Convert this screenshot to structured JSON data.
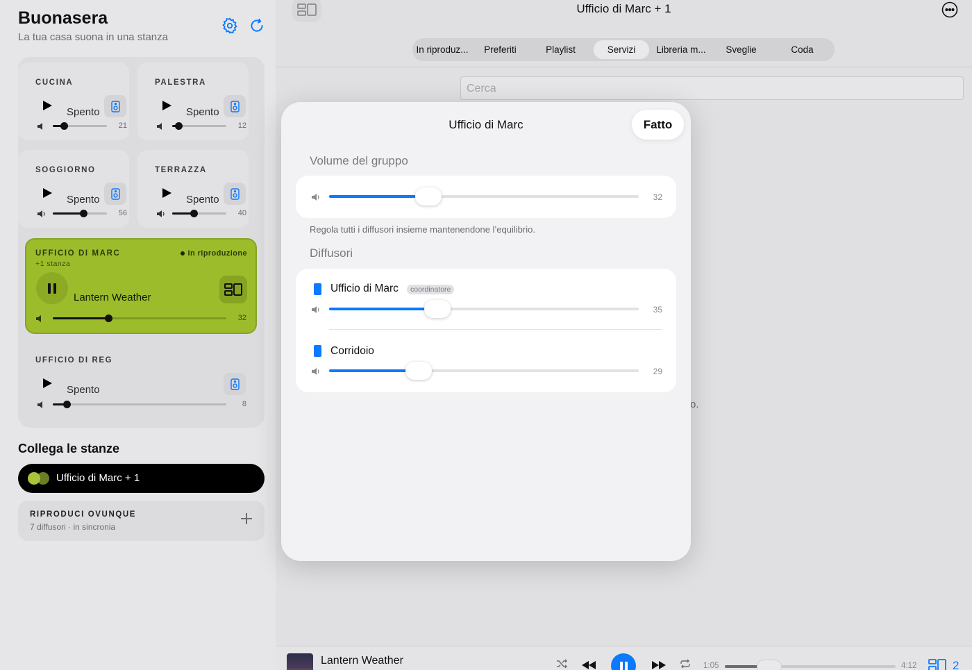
{
  "sidebar": {
    "greeting": "Buonasera",
    "subtitle": "La tua casa suona in una stanza",
    "icons": {
      "settings": "gear-icon",
      "refresh": "refresh-icon"
    },
    "rooms": [
      {
        "name": "CUCINA",
        "status": "Spento",
        "volume": "21",
        "volume_value": 21
      },
      {
        "name": "PALESTRA",
        "status": "Spento",
        "volume": "12",
        "volume_value": 12
      },
      {
        "name": "SOGGIORNO",
        "status": "Spento",
        "volume": "56",
        "volume_value": 56
      },
      {
        "name": "TERRAZZA",
        "status": "Spento",
        "volume": "40",
        "volume_value": 40
      }
    ],
    "active_room": {
      "name": "UFFICIO DI MARC",
      "sub": "+1 stanza",
      "badge": "In riproduzione",
      "track": "Lantern Weather",
      "volume": "32",
      "volume_value": 32,
      "accent": "#9cbc2c"
    },
    "room5": {
      "name": "UFFICIO DI REG",
      "status": "Spento",
      "volume": "8",
      "volume_value": 8
    },
    "link_section_title": "Collega le stanze",
    "link_pill_label": "Ufficio di Marc + 1",
    "anywhere": {
      "title": "RIPRODUCI OVUNQUE",
      "sub": "7 diffusori · in sincronia"
    }
  },
  "main": {
    "title": "Ufficio di Marc + 1",
    "tabs": [
      {
        "label": "In riproduz..."
      },
      {
        "label": "Preferiti"
      },
      {
        "label": "Playlist"
      },
      {
        "label": "Servizi"
      },
      {
        "label": "Libreria m..."
      },
      {
        "label": "Sveglie"
      },
      {
        "label": "Coda"
      }
    ],
    "active_tab": "Servizi",
    "search_placeholder": "Cerca",
    "background_fragment": "o."
  },
  "now_playing": {
    "title": "Lantern Weather",
    "elapsed": "1:05",
    "duration": "4:12",
    "progress": 0.26,
    "group_count": "2",
    "accent": "#0a7aff"
  },
  "modal": {
    "title": "Ufficio di Marc",
    "done_label": "Fatto",
    "group_volume_heading": "Volume del gruppo",
    "group_volume": "32",
    "group_volume_value": 32,
    "caption": "Regola tutti i diffusori insieme mantenendone l’equilibrio.",
    "speakers_heading": "Diffusori",
    "speakers": [
      {
        "name": "Ufficio di Marc",
        "badge": "coordinatore",
        "volume": "35",
        "volume_value": 35
      },
      {
        "name": "Corridoio",
        "volume": "29",
        "volume_value": 29
      }
    ]
  }
}
